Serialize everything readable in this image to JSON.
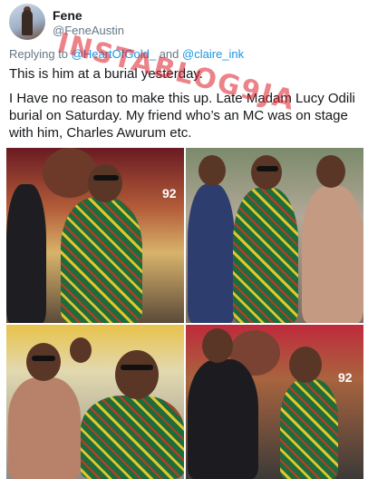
{
  "author": {
    "name": "Fene",
    "handle": "@FeneAustin"
  },
  "reply": {
    "prefix": "Replying to",
    "to1": "@HeartOfGold_",
    "joiner": "and",
    "to2": "@claire_ink"
  },
  "tweet": {
    "line1": "This is him at a burial yesterday.",
    "line2": "I Have no reason to make this up. Late Madam Lucy Odili burial on Saturday. My friend who’s an MC was on stage with him, Charles Awurum etc."
  },
  "watermark": "INSTABLOG9JA",
  "photos": [
    {
      "banner": "92"
    },
    {
      "banner": ""
    },
    {
      "banner": ""
    },
    {
      "banner": "92"
    }
  ],
  "icons": {
    "avatar": "user-avatar"
  }
}
